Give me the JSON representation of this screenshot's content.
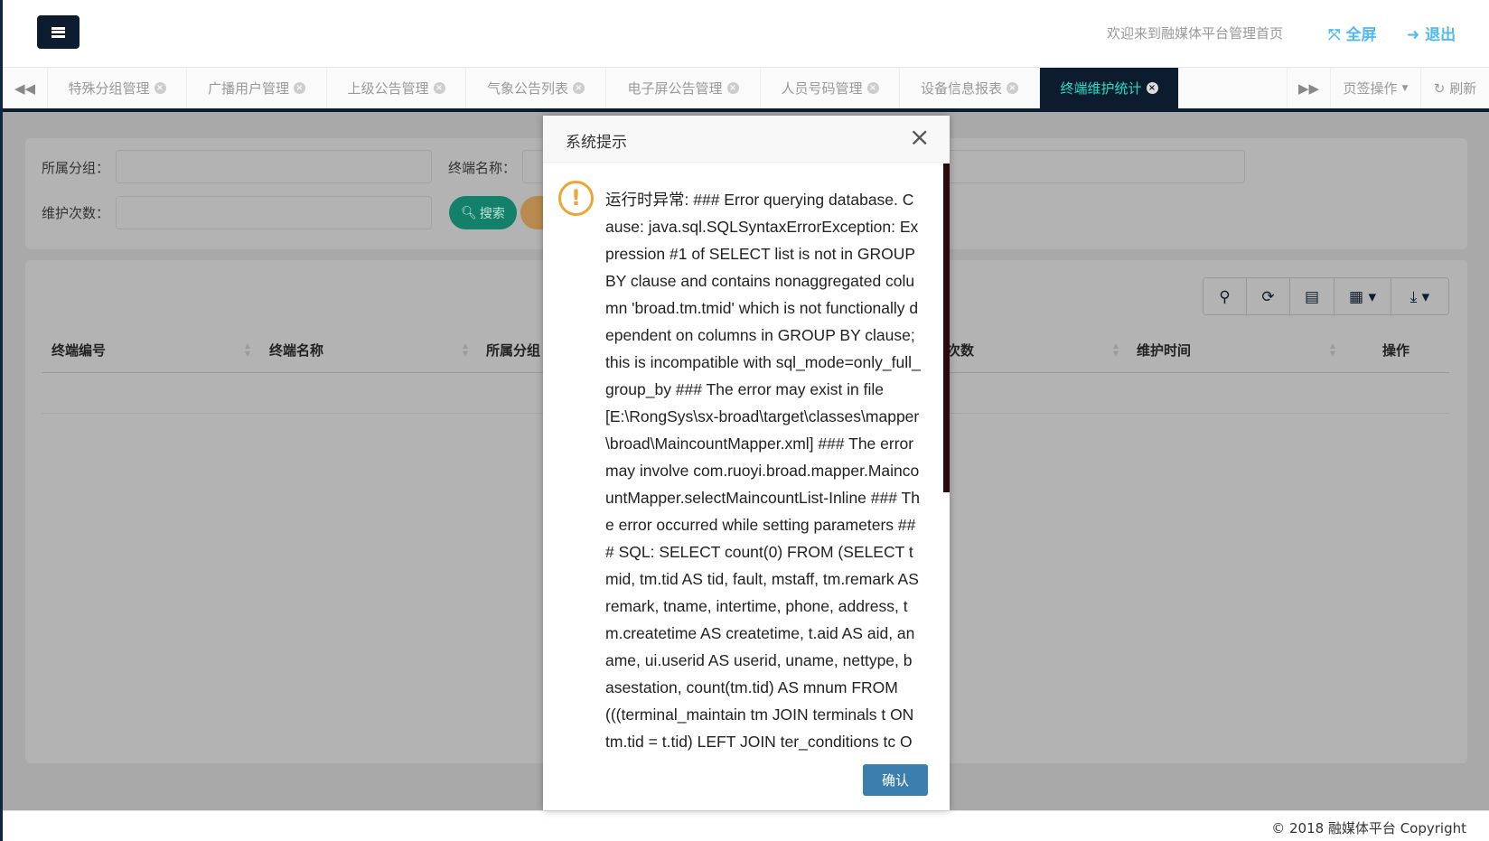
{
  "header": {
    "welcome": "欢迎来到融媒体平台管理首页",
    "fullscreen": "全屏",
    "logout": "退出"
  },
  "tabs": [
    {
      "label": "特殊分组管理"
    },
    {
      "label": "广播用户管理"
    },
    {
      "label": "上级公告管理"
    },
    {
      "label": "气象公告列表"
    },
    {
      "label": "电子屏公告管理"
    },
    {
      "label": "人员号码管理"
    },
    {
      "label": "设备信息报表"
    },
    {
      "label": "终端维护统计",
      "active": true
    }
  ],
  "tabbar": {
    "page_ops": "页签操作",
    "refresh": "刷新"
  },
  "search": {
    "group_label": "所属分组：",
    "name_label": "终端名称：",
    "count_label": "维护次数：",
    "search_btn": "搜索",
    "group_value": "",
    "name_value": "",
    "count_value": ""
  },
  "table": {
    "columns": [
      "终端编号",
      "终端名称",
      "所属分组",
      "",
      "维护次数",
      "维护时间",
      "操作"
    ]
  },
  "modal": {
    "title": "系统提示",
    "lines": [
      "运行时异常: ### Error querying database. C",
      "ause: java.sql.SQLSyntaxErrorException: Ex",
      "pression #1 of SELECT list is not in GROUP",
      "BY clause and contains nonaggregated colu",
      "mn 'broad.tm.tmid' which is not functionally d",
      "ependent on columns in GROUP BY clause;",
      "this is incompatible with sql_mode=only_full_",
      "group_by ### The error may exist in file",
      "[E:\\RongSys\\sx-broad\\target\\classes\\mapper",
      "\\broad\\MaincountMapper.xml] ### The error",
      "may involve com.ruoyi.broad.mapper.Mainco",
      "untMapper.selectMaincountList-Inline ### Th",
      "e error occurred while setting parameters ##",
      "# SQL: SELECT count(0) FROM (SELECT t",
      "mid, tm.tid AS tid, fault, mstaff, tm.remark AS",
      "remark, tname, intertime, phone, address, t",
      "m.createtime AS createtime, t.aid AS aid, an",
      "ame, ui.userid AS userid, uname, nettype, b",
      "asestation, count(tm.tid) AS mnum FROM",
      "(((terminal_maintain tm JOIN terminals t ON",
      "tm.tid = t.tid) LEFT JOIN ter_conditions tc O"
    ],
    "confirm": "确认"
  },
  "footer": {
    "copyright": "© 2018 融媒体平台 Copyright"
  }
}
